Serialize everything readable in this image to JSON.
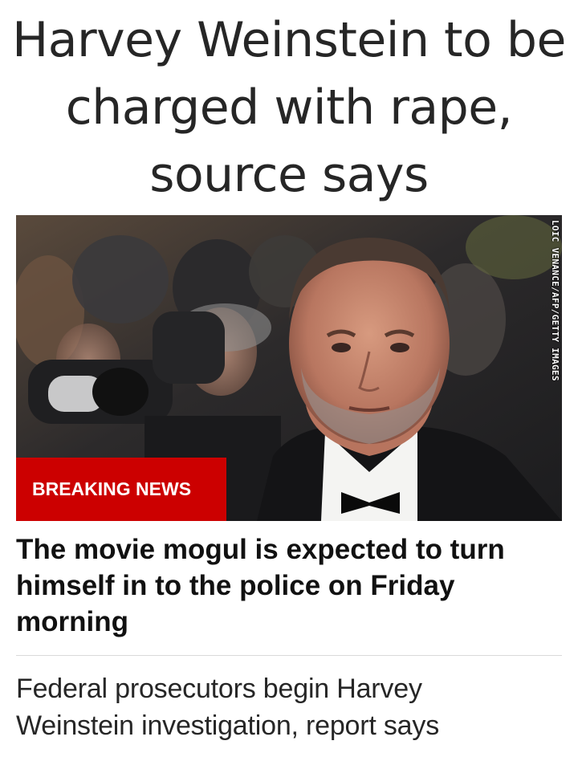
{
  "article": {
    "headline": "Harvey Weinstein to be charged with rape, source says",
    "image": {
      "description_icon": "photo-icon",
      "credit": "LOIC VENANCE/AFP/GETTY IMAGES"
    },
    "badge": {
      "label": "BREAKING NEWS",
      "color": "#cc0000"
    },
    "subheadline": "The movie mogul is expected to turn himself in to the police on Friday morning"
  },
  "related": {
    "title": "Federal prosecutors begin Harvey Weinstein investigation, report says"
  }
}
